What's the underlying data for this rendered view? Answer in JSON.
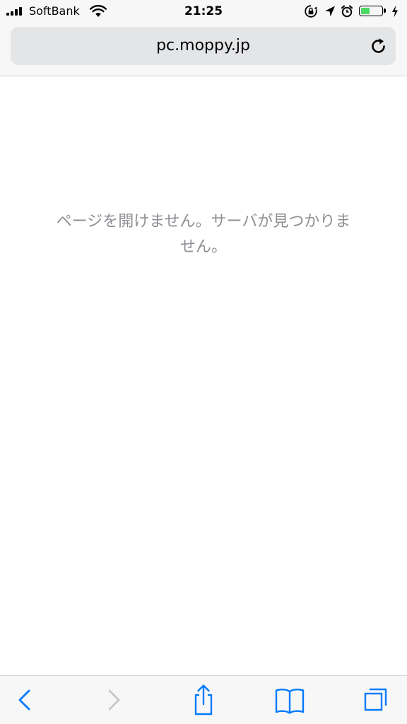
{
  "status_bar": {
    "carrier": "SoftBank",
    "time": "21:25",
    "battery_percent": 45,
    "battery_color": "#4cd964"
  },
  "url_bar": {
    "address": "pc.moppy.jp",
    "reload_icon": "reload-icon"
  },
  "page": {
    "error_message": "ページを開けません。サーバが見つかりません。",
    "text_color": "#8e8e93"
  },
  "toolbar": {
    "accent_color": "#007aff",
    "disabled_color": "#c7c7cc",
    "buttons": [
      {
        "name": "back",
        "icon": "chevron-left-icon",
        "enabled": true
      },
      {
        "name": "forward",
        "icon": "chevron-right-icon",
        "enabled": false
      },
      {
        "name": "share",
        "icon": "share-icon",
        "enabled": true
      },
      {
        "name": "bookmarks",
        "icon": "book-icon",
        "enabled": true
      },
      {
        "name": "tabs",
        "icon": "tabs-icon",
        "enabled": true
      }
    ]
  }
}
